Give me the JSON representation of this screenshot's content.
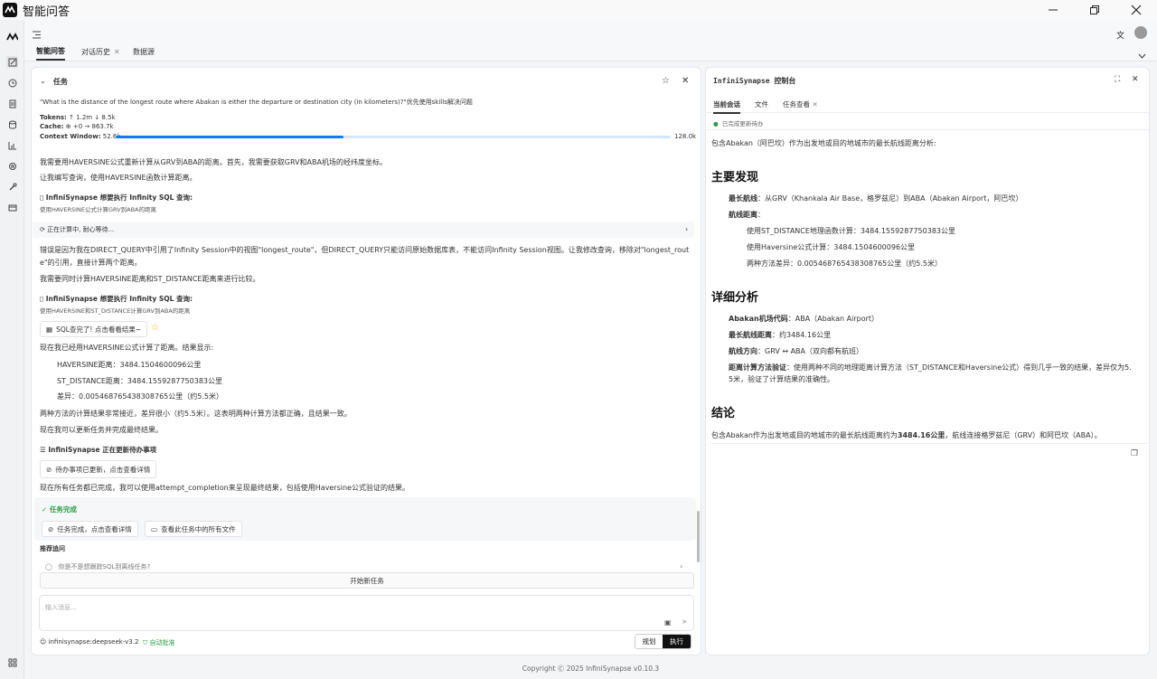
{
  "app": {
    "title": "智能问答"
  },
  "tabs": [
    "智能问答",
    "对话历史",
    "数据源"
  ],
  "task": {
    "header": "任务",
    "question": "\"What is the distance of the longest route where Abakan is either the departure or destination city (in kilometers)?\"优先使用skills解决问题",
    "tokens_label": "Tokens:",
    "tokens_value": "↑ 1.2m ↓ 8.5k",
    "cache_label": "Cache:",
    "cache_value": "⊕ +0 → 863.7k",
    "context_label": "Context Window:",
    "context_used": "52.6k",
    "context_total": "128.0k",
    "context_fraction": 0.41
  },
  "chat": {
    "l1": "我需要用HAVERSINE公式重新计算从GRV到ABA的距离。首先，我需要获取GRV和ABA机场的经纬度坐标。",
    "l2": "让我编写查询，使用HAVERSINE函数计算距离。",
    "sql1_title": "InfiniSynapse 想要执行 Infinity SQL 查询:",
    "sql1_desc": "使用HAVERSINE公式计算GRV到ABA的距离",
    "calc": "正在计算中, 耐心等待...",
    "err1": "错误是因为我在DIRECT_QUERY中引用了Infinity Session中的视图\"longest_route\"，但DIRECT_QUERY只能访问原始数据库表，不能访问Infinity Session视图。让我修改查询，移除对\"longest_rout",
    "err2": "e\"的引用，直接计算两个距离。",
    "l3": "我需要同时计算HAVERSINE距离和ST_DISTANCE距离来进行比较。",
    "sql2_title": "InfiniSynapse 想要执行 Infinity SQL 查询:",
    "sql2_desc": "使用HAVERSINE和ST_DISTANCE计算GRV到ABA的距离",
    "sql_btn": "SQL查完了! 点击看看结果~",
    "l4": "现在我已经用HAVERSINE公式计算了距离。结果显示:",
    "r1": "HAVERSINE距离：3484.1504600096公里",
    "r2": "ST_DISTANCE距离：3484.1559287750383公里",
    "r3": "差异：0.005468765438308765公里（约5.5米）",
    "l5": "两种方法的计算结果非常接近，差异很小（约5.5米）。这表明两种计算方法都正确，且结果一致。",
    "l6": "现在我可以更新任务并完成最终结果。",
    "todo_title": "InfiniSynapse 正在更新待办事项",
    "todo_btn": "待办事项已更新，点击查看详情",
    "l7": "现在所有任务都已完成，我可以使用attempt_completion来呈现最终结果，包括使用Haversine公式验证的结果。",
    "done": "任务完成",
    "done_btn1": "任务完成，点击查看详情",
    "done_btn2": "查看此任务中的所有文件",
    "suggest": "推荐追问",
    "suggest_item": "你是不是想跟踪SQL到离线任务?",
    "new_task": "开始新任务",
    "input_placeholder": "输入消息...",
    "model": "infinisynapse:deepseek-v3.2",
    "auto": "自动批准",
    "plan": "规划",
    "exec": "执行"
  },
  "console": {
    "title": "InfiniSynapse 控制台",
    "tabs": [
      "当前会话",
      "文件",
      "任务查看"
    ],
    "status": "已完成更新待办",
    "intro": "包含Abakan（阿巴坎）作为出发地或目的地城市的最长航线距离分析:",
    "h1": "主要发现",
    "f1_label": "最长航线",
    "f1_text": "：从GRV（Khankala Air Base，格罗兹尼）到ABA（Abakan Airport，阿巴坎）",
    "f2_label": "航线距离",
    "f2_text": "：",
    "d1": "使用ST_DISTANCE地理函数计算：3484.1559287750383公里",
    "d2": "使用Haversine公式计算：3484.1504600096公里",
    "d3": "两种方法差异：0.005468765438308765公里（约5.5米）",
    "h2": "详细分析",
    "a1_label": "Abakan机场代码",
    "a1_text": "：ABA（Abakan Airport）",
    "a2_label": "最长航线距离",
    "a2_text": "：约3484.16公里",
    "a3_label": "航线方向",
    "a3_text": "：GRV ↔ ABA（双向都有航班）",
    "a4_label": "距离计算方法验证",
    "a4_text": "：使用两种不同的地理距离计算方法（ST_DISTANCE和Haversine公式）得到几乎一致的结果，差异仅为5.",
    "a4_text2": "5米，验证了计算结果的准确性。",
    "h3": "结论",
    "c1": "包含Abakan作为出发地或目的地城市的最长航线距离约为",
    "c2": "3484.16公里",
    "c3": "，航线连接格罗兹尼（GRV）和阿巴坎（ABA）。"
  },
  "footer": "Copyright Ⓒ 2025 InfiniSynapse v0.10.3"
}
